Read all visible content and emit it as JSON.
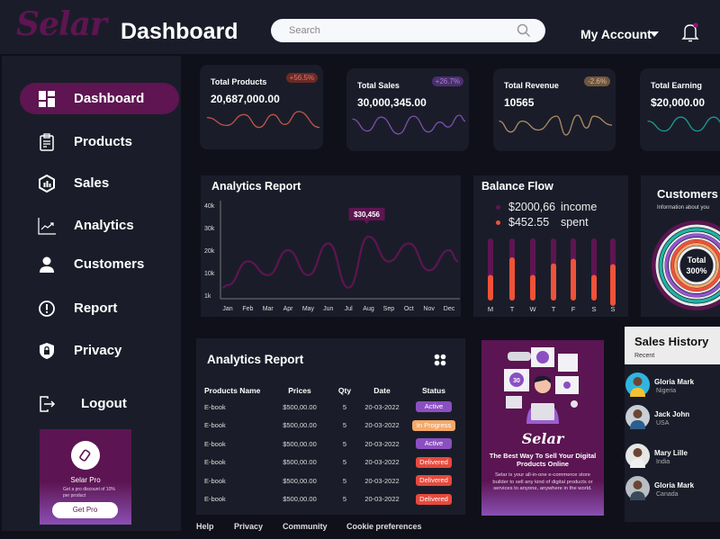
{
  "header": {
    "logo": "Selar",
    "title": "Dashboard",
    "search_placeholder": "Search",
    "account_label": "My Account"
  },
  "sidebar": {
    "items": [
      {
        "label": "Dashboard",
        "icon": "dashboard-grid-icon",
        "active": true
      },
      {
        "label": "Products",
        "icon": "clipboard-icon"
      },
      {
        "label": "Sales",
        "icon": "hexagon-chart-icon"
      },
      {
        "label": "Analytics",
        "icon": "trend-chart-icon"
      },
      {
        "label": "Customers",
        "icon": "user-icon"
      },
      {
        "label": "Report",
        "icon": "alert-circle-icon"
      },
      {
        "label": "Privacy",
        "icon": "shield-lock-icon"
      }
    ],
    "logout": "Logout",
    "pro": {
      "title": "Selar Pro",
      "description": "Get a pro discount of 10% per product",
      "button": "Get Pro"
    }
  },
  "stats": [
    {
      "title": "Total Products",
      "value": "20,687,000.00",
      "badge": "+56.5%",
      "color": "#c2564a",
      "badge_bg": "#6b2a26"
    },
    {
      "title": "Total Sales",
      "value": "30,000,345.00",
      "badge": "+26.7%",
      "color": "#7d4fb0",
      "badge_bg": "#4a2f6e"
    },
    {
      "title": "Total Revenue",
      "value": "10565",
      "badge": "-2.6%",
      "color": "#b08a66",
      "badge_bg": "#6e5640"
    },
    {
      "title": "Total Earning",
      "value": "$20,000.00",
      "badge": "",
      "color": "#1f9a94",
      "badge_bg": ""
    }
  ],
  "analytics_chart": {
    "title": "Analytics Report",
    "tooltip": "$30,456",
    "chart_data": {
      "type": "line",
      "title": "Analytics Report",
      "categories": [
        "Jan",
        "Feb",
        "Mar",
        "Apr",
        "May",
        "Jun",
        "Jul",
        "Aug",
        "Sep",
        "Oct",
        "Nov",
        "Dec"
      ],
      "y_ticks": [
        "1k",
        "10k",
        "20k",
        "30k",
        "40k"
      ],
      "values": [
        5000,
        15000,
        9000,
        20000,
        9000,
        23000,
        4000,
        26000,
        15000,
        23000,
        11000,
        20000
      ],
      "end_value": 15000,
      "highlight": {
        "category": "Aug",
        "label": "$30,456"
      },
      "color": "#5e1551"
    }
  },
  "balance_flow": {
    "title": "Balance Flow",
    "income_amount": "$2000,66",
    "income_label": "income",
    "spent_amount": "$452.55",
    "spent_label": "spent",
    "income_color": "#5e1551",
    "spent_color": "#ef5239",
    "chart_data": {
      "type": "bar",
      "categories": [
        "M",
        "T",
        "W",
        "T",
        "F",
        "S",
        "S"
      ],
      "spent_fraction": [
        0.38,
        0.64,
        0.38,
        0.55,
        0.62,
        0.38,
        0.62
      ]
    }
  },
  "customers": {
    "title": "Customers",
    "subtitle": "Information about you",
    "center_label": "Total",
    "center_value": "300%"
  },
  "table": {
    "title": "Analytics Report",
    "columns": [
      "Products Name",
      "Prices",
      "Qty",
      "Date",
      "Status"
    ],
    "rows": [
      {
        "name": "E-book",
        "price": "$500,00.00",
        "qty": "5",
        "date": "20-03-2022",
        "status": "Active",
        "color": "#8c4fc2"
      },
      {
        "name": "E-book",
        "price": "$500,00.00",
        "qty": "5",
        "date": "20-03-2022",
        "status": "In Progress",
        "color": "#f4a96a"
      },
      {
        "name": "E-book",
        "price": "$500,00.00",
        "qty": "5",
        "date": "20-03-2022",
        "status": "Active",
        "color": "#8c4fc2"
      },
      {
        "name": "E-book",
        "price": "$500,00.00",
        "qty": "5",
        "date": "20-03-2022",
        "status": "Delivered",
        "color": "#e7493c"
      },
      {
        "name": "E-book",
        "price": "$500,00.00",
        "qty": "5",
        "date": "20-03-2022",
        "status": "Delivered",
        "color": "#e7493c"
      },
      {
        "name": "E-book",
        "price": "$500,00.00",
        "qty": "5",
        "date": "20-03-2022",
        "status": "Delivered",
        "color": "#e7493c"
      }
    ]
  },
  "promo": {
    "logo": "Selar",
    "headline": "The Best Way To Sell Your Digital Products Online",
    "body": "Selar is your all-in-one e-commerce store builder to sell any kind of digital products or services to anyone, anywhere in the world.",
    "badge": "30"
  },
  "sales_history": {
    "title": "Sales History",
    "subtitle": "Recent",
    "people": [
      {
        "name": "Gloria Mark",
        "country": "Nigeria",
        "avatar_color": "#2fb6e0"
      },
      {
        "name": "Jack John",
        "country": "USA",
        "avatar_color": "#c9cfd6"
      },
      {
        "name": "Mary Lille",
        "country": "India",
        "avatar_color": "#e6e6e6"
      },
      {
        "name": "Gloria Mark",
        "country": "Canada",
        "avatar_color": "#b8bec4"
      }
    ]
  },
  "footer": {
    "links": [
      "Help",
      "Privacy",
      "Community",
      "Cookie preferences"
    ]
  }
}
